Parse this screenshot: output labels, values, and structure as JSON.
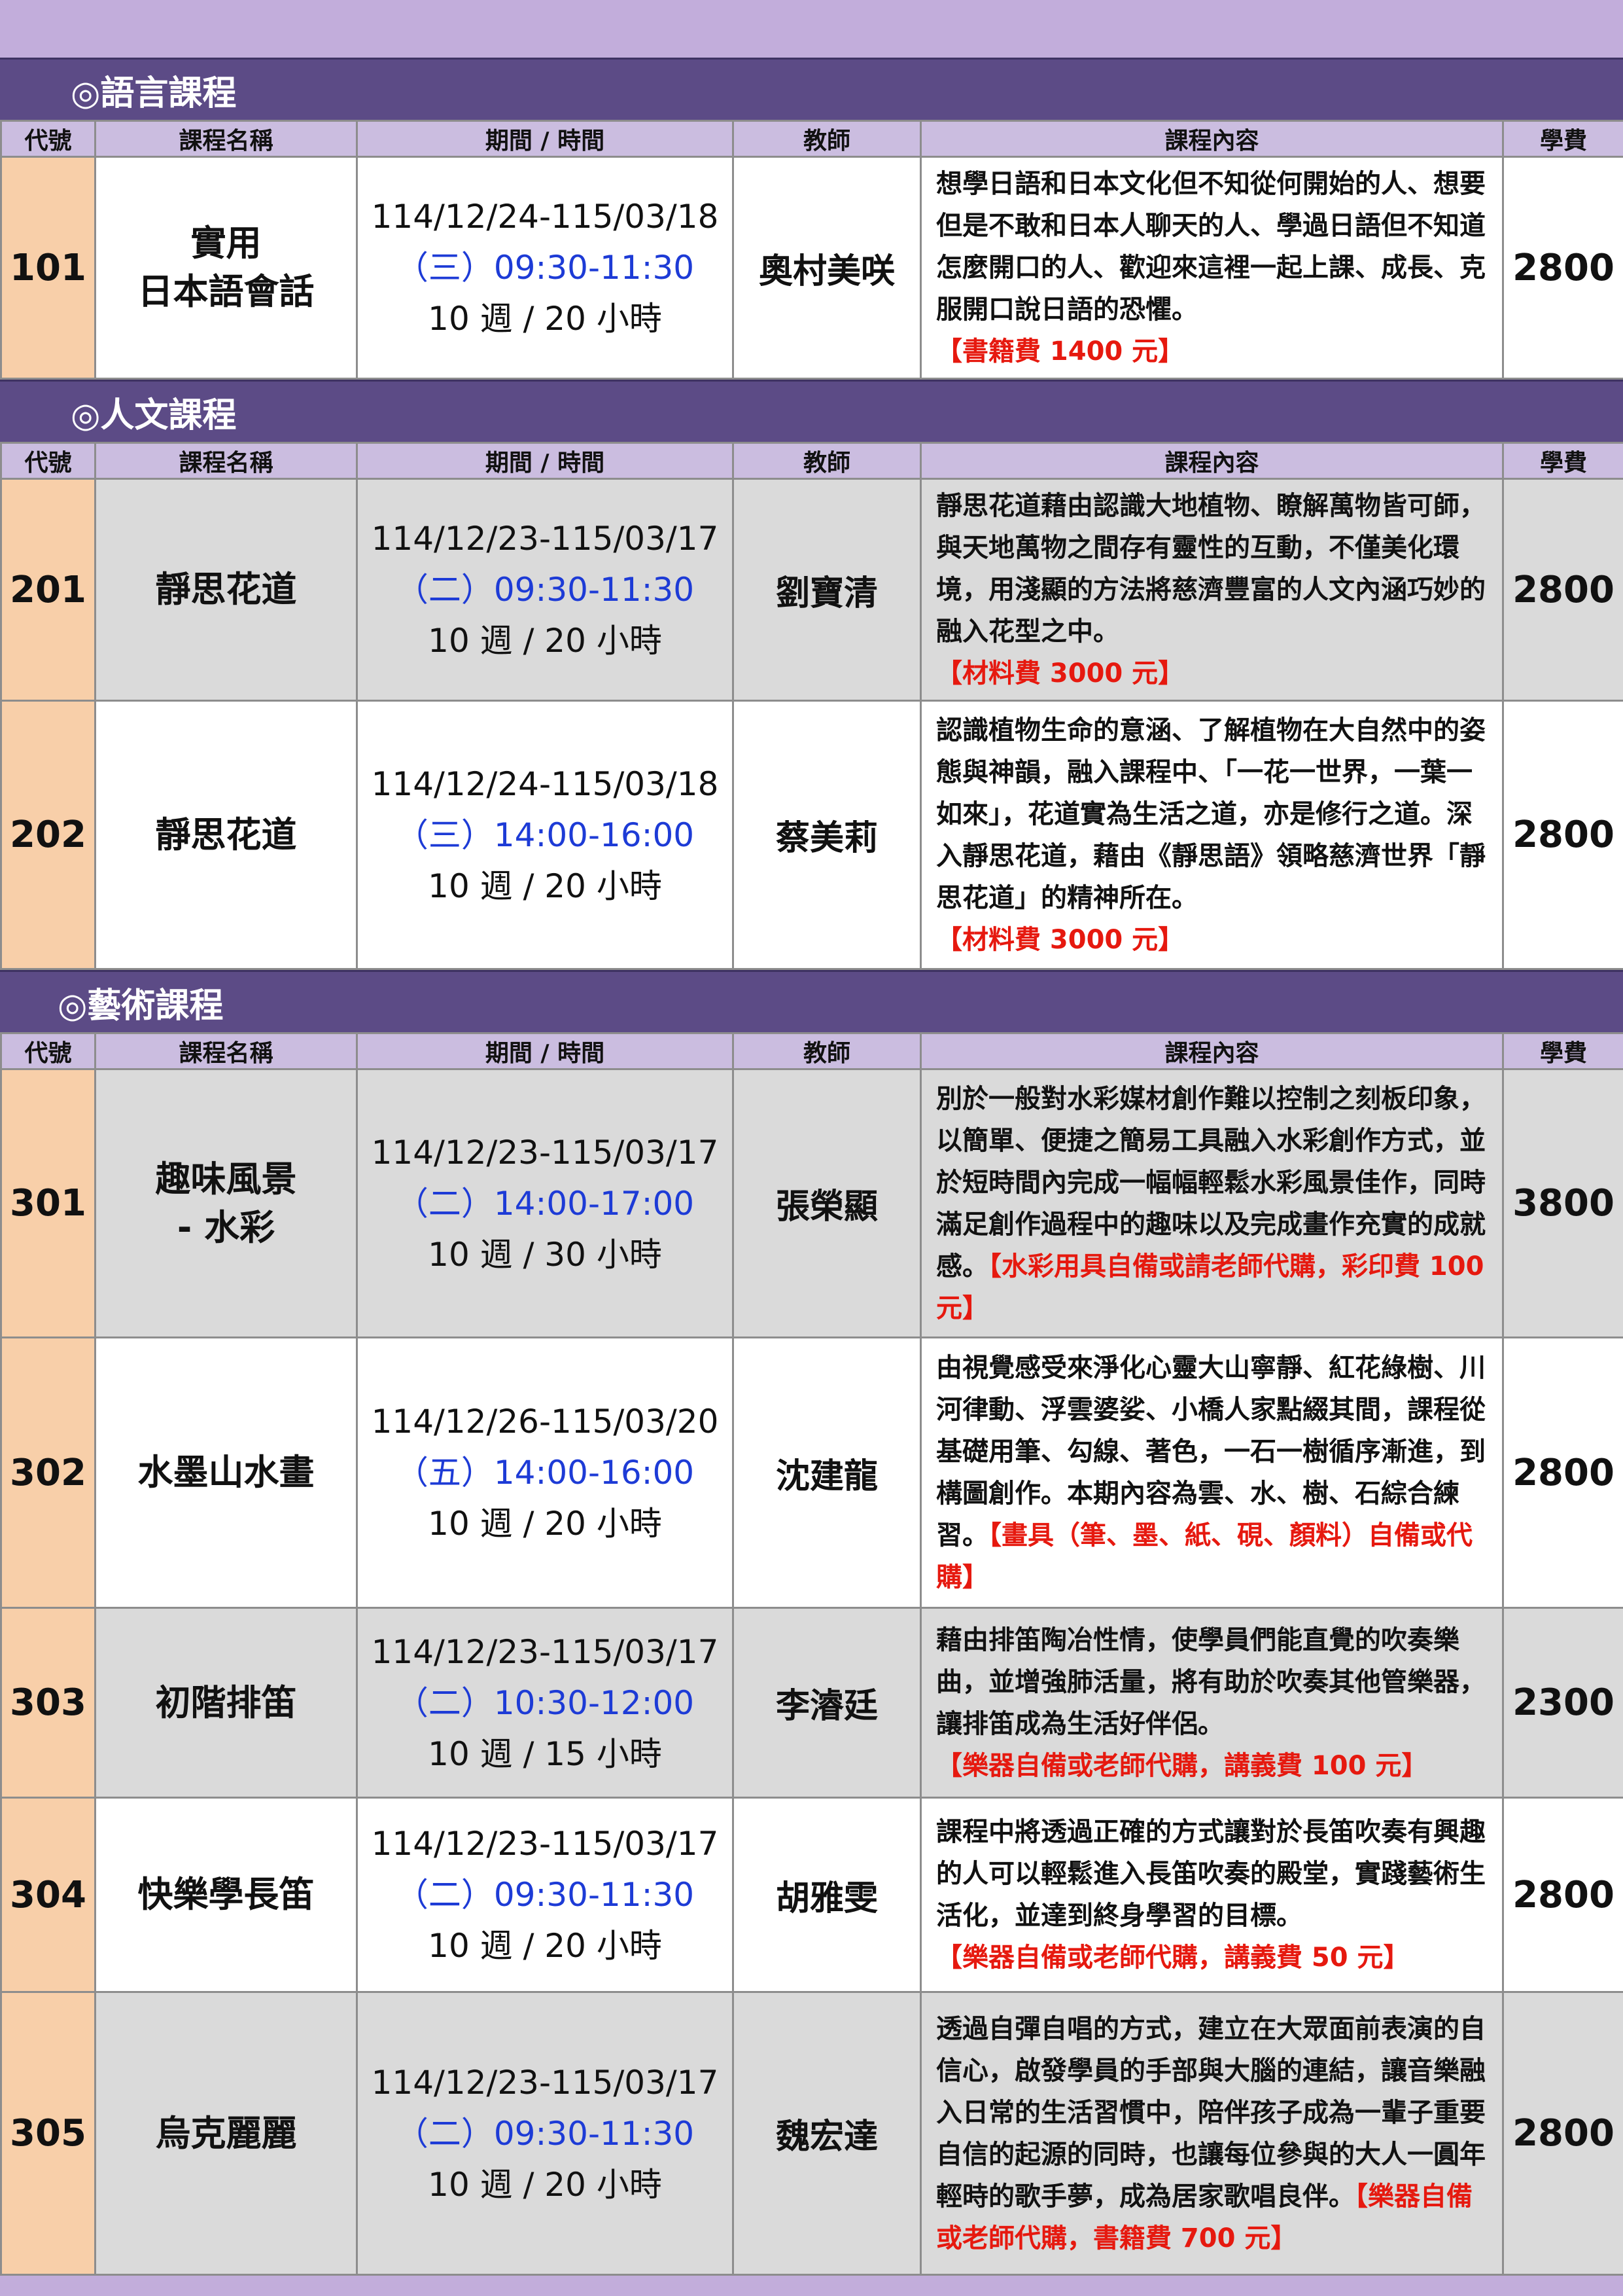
{
  "sections": [
    {
      "title": "◎語言課程",
      "headers": [
        "代號",
        "課程名稱",
        "期間 / 時間",
        "教師",
        "課程內容",
        "學費"
      ],
      "courses": [
        {
          "code": "101",
          "name_lines": [
            "實用",
            "日本語會話"
          ],
          "period": "114/12/24-115/03/18",
          "day_time": "（三）09:30-11:30",
          "duration": "10 週 / 20 小時",
          "teacher": "奧村美咲",
          "description": "想學日語和日本文化但不知從何開始的人、想要但是不敢和日本人聊天的人、學過日語但不知道怎麼開口的人、歡迎來這裡一起上課、成長、克服開口說日語的恐懼。",
          "note": "【書籍費 1400 元】",
          "fee": "2800"
        }
      ]
    },
    {
      "title": "◎人文課程",
      "headers": [
        "代號",
        "課程名稱",
        "期間 / 時間",
        "教師",
        "課程內容",
        "學費"
      ],
      "courses": [
        {
          "code": "201",
          "name_lines": [
            "靜思花道"
          ],
          "period": "114/12/23-115/03/17",
          "day_time": "（二）09:30-11:30",
          "duration": "10 週 / 20 小時",
          "teacher": "劉寶清",
          "description": "靜思花道藉由認識大地植物、瞭解萬物皆可師，與天地萬物之間存有靈性的互動，不僅美化環境，用淺顯的方法將慈濟豐富的人文內涵巧妙的融入花型之中。",
          "note": "【材料費 3000 元】",
          "fee": "2800"
        },
        {
          "code": "202",
          "name_lines": [
            "靜思花道"
          ],
          "period": "114/12/24-115/03/18",
          "day_time": "（三）14:00-16:00",
          "duration": "10 週 / 20 小時",
          "teacher": "蔡美莉",
          "description": "認識植物生命的意涵、了解植物在大自然中的姿態與神韻，融入課程中、「一花一世界，一葉一如來」，花道實為生活之道，亦是修行之道。深入靜思花道，藉由《靜思語》領略慈濟世界「靜思花道」的精神所在。",
          "note": "【材料費 3000 元】",
          "fee": "2800"
        }
      ]
    },
    {
      "title": "◎藝術課程",
      "headers": [
        "代號",
        "課程名稱",
        "期間 / 時間",
        "教師",
        "課程內容",
        "學費"
      ],
      "courses": [
        {
          "code": "301",
          "name_lines": [
            "趣味風景",
            "- 水彩"
          ],
          "period": "114/12/23-115/03/17",
          "day_time": "（二）14:00-17:00",
          "duration": "10 週 / 30 小時",
          "teacher": "張榮顯",
          "description": "別於一般對水彩媒材創作難以控制之刻板印象，以簡單、便捷之簡易工具融入水彩創作方式，並於短時間內完成一幅幅輕鬆水彩風景佳作，同時滿足創作過程中的趣味以及完成畫作充實的成就感。",
          "note": "【水彩用具自備或請老師代購，彩印費 100 元】",
          "fee": "3800"
        },
        {
          "code": "302",
          "name_lines": [
            "水墨山水畫"
          ],
          "period": "114/12/26-115/03/20",
          "day_time": "（五）14:00-16:00",
          "duration": "10 週 / 20 小時",
          "teacher": "沈建龍",
          "description": "由視覺感受來淨化心靈大山寧靜、紅花綠樹、川河律動、浮雲婆娑、小橋人家點綴其間，課程從基礎用筆、勾線、著色，一石一樹循序漸進，到構圖創作。本期內容為雲、水、樹、石綜合練習。",
          "note": "【畫具（筆、墨、紙、硯、顏料）自備或代購】",
          "fee": "2800"
        },
        {
          "code": "303",
          "name_lines": [
            "初階排笛"
          ],
          "period": "114/12/23-115/03/17",
          "day_time": "（二）10:30-12:00",
          "duration": "10 週 / 15 小時",
          "teacher": "李濬廷",
          "description": "藉由排笛陶冶性情，使學員們能直覺的吹奏樂曲，並增強肺活量，將有助於吹奏其他管樂器，讓排笛成為生活好伴侶。",
          "note": "【樂器自備或老師代購，講義費 100 元】",
          "fee": "2300"
        },
        {
          "code": "304",
          "name_lines": [
            "快樂學長笛"
          ],
          "period": "114/12/23-115/03/17",
          "day_time": "（二）09:30-11:30",
          "duration": "10 週 / 20 小時",
          "teacher": "胡雅雯",
          "description": "課程中將透過正確的方式讓對於長笛吹奏有興趣的人可以輕鬆進入長笛吹奏的殿堂，實踐藝術生活化，並達到終身學習的目標。",
          "note": "【樂器自備或老師代購，講義費 50 元】",
          "fee": "2800"
        },
        {
          "code": "305",
          "name_lines": [
            "烏克麗麗"
          ],
          "period": "114/12/23-115/03/17",
          "day_time": "（二）09:30-11:30",
          "duration": "10 週 / 20 小時",
          "teacher": "魏宏達",
          "description": "透過自彈自唱的方式，建立在大眾面前表演的自信心，啟發學員的手部與大腦的連結，讓音樂融入日常的生活習慣中，陪伴孩子成為一輩子重要自信的起源的同時，也讓每位參與的大人一圓年輕時的歌手夢，成為居家歌唱良伴。",
          "note": "【樂器自備或老師代購，書籍費 700 元】",
          "fee": "2800"
        }
      ]
    }
  ]
}
